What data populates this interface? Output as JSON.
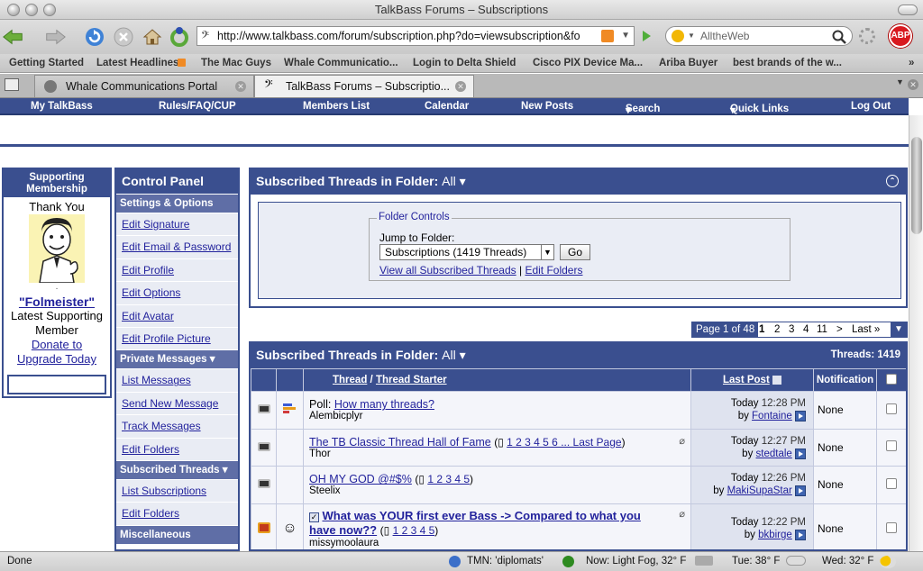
{
  "window": {
    "title": "TalkBass Forums – Subscriptions"
  },
  "toolbar": {
    "url": "http://www.talkbass.com/forum/subscription.php?do=viewsubscription&fo",
    "search_engine": "AlltheWeb",
    "abp_label": "ABP"
  },
  "bookmarks": [
    "Getting Started",
    "Latest Headlines",
    "The Mac Guys",
    "Whale Communicatio...",
    "Login to Delta Shield",
    "Cisco PIX Device Ma...",
    "Ariba Buyer",
    "best brands of the w..."
  ],
  "tabs": [
    {
      "label": "Whale Communications Portal"
    },
    {
      "label": "TalkBass Forums – Subscriptio..."
    }
  ],
  "nav": [
    "My TalkBass",
    "Rules/FAQ/CUP",
    "Members List",
    "Calendar",
    "New Posts",
    "Search",
    "Quick Links",
    "Log Out"
  ],
  "supporting": {
    "header": "Supporting Membership",
    "thanks": "Thank You",
    "dot": ".",
    "member_name": "\"Folmeister\"",
    "line1": "Latest Supporting",
    "line2": "Member",
    "donate1": "Donate to",
    "donate2": "Upgrade Today"
  },
  "control_panel": {
    "title": "Control Panel",
    "sections": [
      {
        "header": "Settings & Options",
        "items": [
          "Edit Signature",
          "Edit Email & Password",
          "Edit Profile",
          "Edit Options",
          "Edit Avatar",
          "Edit Profile Picture"
        ]
      },
      {
        "header": "Private Messages",
        "items": [
          "List Messages",
          "Send New Message",
          "Track Messages",
          "Edit Folders"
        ]
      },
      {
        "header": "Subscribed Threads",
        "items": [
          "List Subscriptions",
          "Edit Folders"
        ]
      },
      {
        "header": "Miscellaneous",
        "items": []
      }
    ]
  },
  "folder_panel": {
    "title": "Subscribed Threads in Folder:",
    "folder": "All",
    "legend": "Folder Controls",
    "jump_label": "Jump to Folder:",
    "select_value": "Subscriptions (1419 Threads)",
    "go_label": "Go",
    "view_all": "View all Subscribed Threads",
    "sep": "|",
    "edit_folders": "Edit Folders"
  },
  "pager": {
    "page_label": "Page 1 of 48",
    "pages": [
      "1",
      "2",
      "3",
      "4",
      "11",
      ">",
      "Last »"
    ]
  },
  "threads_panel": {
    "title": "Subscribed Threads in Folder:",
    "folder": "All",
    "count": "Threads: 1419",
    "col_thread": "Thread",
    "col_slash": "/",
    "col_starter": "Thread Starter",
    "col_lastpost": "Last Post",
    "col_notification": "Notification",
    "rows": [
      {
        "prefix": "Poll:",
        "title": "How many threads?",
        "pages": "",
        "starter": "Alembicplyr",
        "date": "Today",
        "time": "12:28 PM",
        "by": "Fontaine",
        "notif": "None",
        "bold": false
      },
      {
        "prefix": "",
        "title": "The TB Classic Thread Hall of Fame",
        "pages": "1 2 3 4 5 6 ... Last Page",
        "starter": "Thor",
        "date": "Today",
        "time": "12:27 PM",
        "by": "stedtale",
        "notif": "None",
        "bold": false
      },
      {
        "prefix": "",
        "title": "OH MY GOD @#$%",
        "pages": "1 2 3 4 5",
        "starter": "Steelix",
        "date": "Today",
        "time": "12:26 PM",
        "by": "MakiSupaStar",
        "notif": "None",
        "bold": false
      },
      {
        "prefix": "",
        "title": "What was YOUR first ever Bass -> Compared to what you have now??",
        "pages": "1 2 3 4 5",
        "starter": "missymoolaura",
        "date": "Today",
        "time": "12:22 PM",
        "by": "bkbirge",
        "notif": "None",
        "bold": true
      }
    ]
  },
  "status": {
    "left": "Done",
    "tmn": "TMN: 'diplomats'",
    "weather_now": "Now: Light Fog, 32° F",
    "tue": "Tue: 38° F",
    "wed": "Wed: 32° F"
  }
}
